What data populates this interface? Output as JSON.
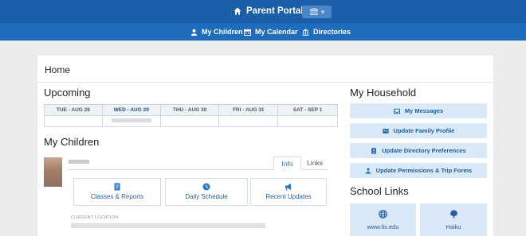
{
  "header": {
    "portal_title": "Parent Portal",
    "switcher_label": "▾",
    "nav": [
      {
        "label": "My Children",
        "icon": "person-icon"
      },
      {
        "label": "My Calendar",
        "icon": "calendar-icon"
      },
      {
        "label": "Directories",
        "icon": "school-building-icon"
      }
    ]
  },
  "breadcrumb": "Home",
  "upcoming": {
    "title": "Upcoming",
    "days": [
      "TUE - AUG 28",
      "WED - AUG 29",
      "THU - AUG 30",
      "FRI - AUG 31",
      "SAT - SEP 1"
    ],
    "today_index": 1
  },
  "my_children": {
    "title": "My Children",
    "tabs": [
      "Info",
      "Links"
    ],
    "active_tab": "Info",
    "cards": [
      {
        "label": "Classes & Reports",
        "icon": "document-icon"
      },
      {
        "label": "Daily Schedule",
        "icon": "clock-icon"
      },
      {
        "label": "Recent Updates",
        "icon": "megaphone-icon"
      }
    ],
    "current_location_label": "CURRENT LOCATION"
  },
  "household": {
    "title": "My Household",
    "buttons": [
      {
        "label": "My Messages",
        "icon": "inbox-icon"
      },
      {
        "label": "Update Family Profile",
        "icon": "id-card-icon"
      },
      {
        "label": "Update Directory Preferences",
        "icon": "address-book-icon"
      },
      {
        "label": "Update Permissions & Trip Forms",
        "icon": "person-download-icon"
      }
    ]
  },
  "school_links": {
    "title": "School Links",
    "links": [
      {
        "label": "www.fis.edu",
        "icon": "globe-icon"
      },
      {
        "label": "Haiku",
        "icon": "tree-icon"
      }
    ]
  },
  "colors": {
    "topbar": "#1a5fa8",
    "navbar": "#1e6cbb",
    "today_highlight": "#86c3f0",
    "button_bg": "#d9e9f7",
    "link_blue": "#1f5d9e"
  }
}
